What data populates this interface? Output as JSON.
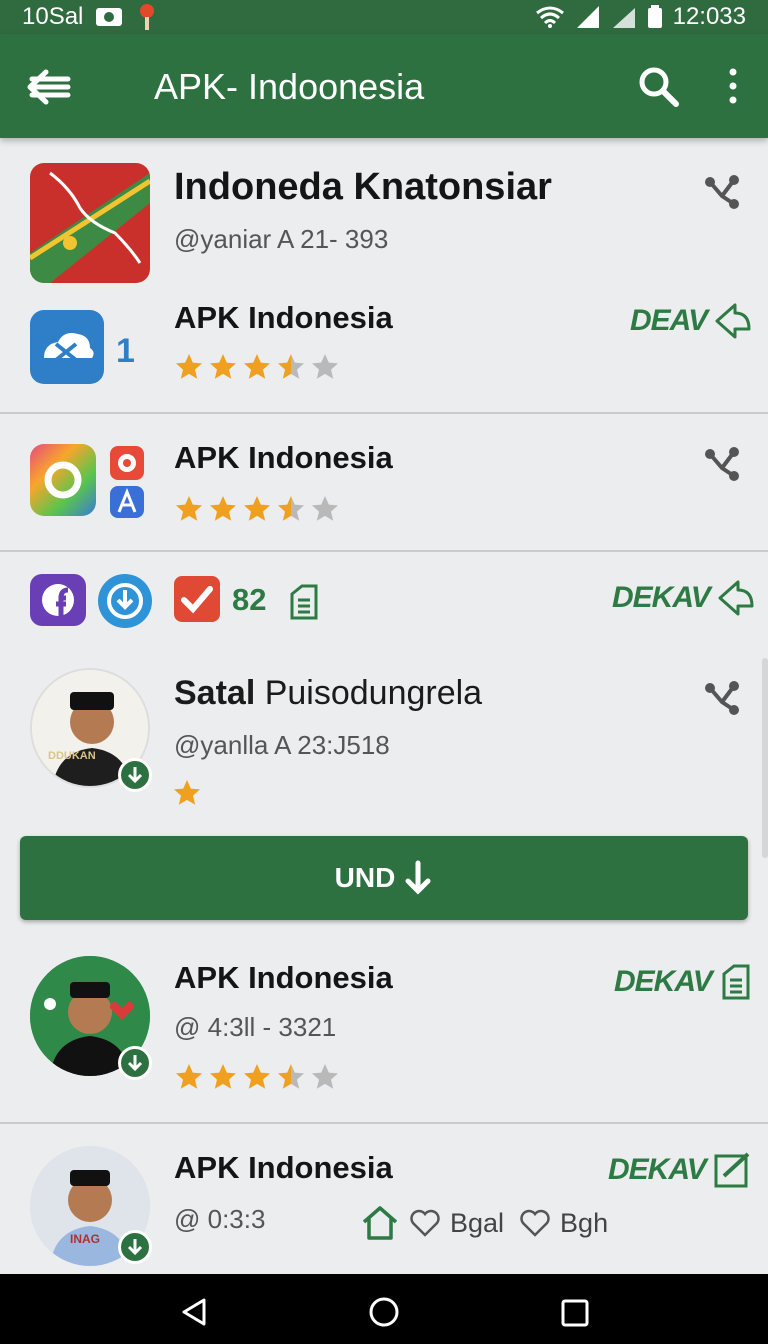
{
  "status_bar": {
    "left_text": "10Sal",
    "time": "12:033"
  },
  "app_bar": {
    "title": "APK- Indoonesia"
  },
  "items": [
    {
      "name": "Indoneda Knatonsiar",
      "handle": "@yaniar A 21- 393"
    },
    {
      "name": "APK Indonesia",
      "count": "1",
      "action": "DEAV",
      "rating": 3.5
    },
    {
      "name": "APK Indonesia",
      "rating": 3.5
    },
    {
      "count": "82",
      "action": "DEKAV"
    },
    {
      "name_bold": "Satal",
      "name_rest": " Puisodungrela",
      "handle": "@yanlla A 23:J518",
      "rating": 1,
      "avatar_text": "DDUKAN"
    },
    {
      "name": "APK Indonesia",
      "handle": "@ 4:3ll - 3321",
      "action": "DEKAV",
      "rating": 3.5
    },
    {
      "name": "APK Indonesia",
      "handle": "@ 0:3:3",
      "action": "DEKAV",
      "tag1": "Bgal",
      "tag2": "Bgh",
      "avatar_text": "INAG"
    }
  ],
  "download_button": {
    "label": "UND"
  },
  "colors": {
    "primary": "#2e7140",
    "accent_green": "#2d7a44",
    "star_gold": "#f0a020",
    "star_grey": "#b9b9b9"
  },
  "icons": {
    "back": "back-arrow-icon",
    "search": "search-icon",
    "more": "more-vert-icon",
    "share": "share-icon",
    "action": "action-arrow-icon",
    "download": "download-icon"
  }
}
